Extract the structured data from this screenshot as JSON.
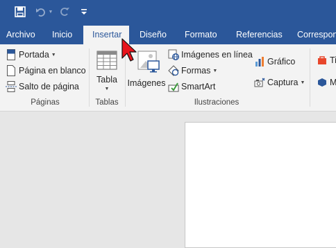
{
  "qat": {
    "save_icon": "save-icon",
    "undo_icon": "undo-icon",
    "redo_icon": "redo-icon",
    "customize_icon": "customize-qat-icon"
  },
  "tabs": [
    "Archivo",
    "Inicio",
    "Insertar",
    "Diseño",
    "Formato",
    "Referencias",
    "Correspon"
  ],
  "active_tab": "Insertar",
  "ribbon": {
    "pages": {
      "items": [
        "Portada",
        "Página en blanco",
        "Salto de página"
      ],
      "label": "Páginas"
    },
    "tables": {
      "button": "Tabla",
      "label": "Tablas"
    },
    "illustrations": {
      "images": "Imágenes",
      "online_images": "Imágenes en línea",
      "shapes": "Formas",
      "smartart": "SmartArt",
      "chart": "Gráfico",
      "screenshot": "Captura",
      "label": "Ilustraciones"
    },
    "partial": [
      "Ti",
      "M"
    ]
  },
  "colors": {
    "brand": "#2b579a",
    "ribbon_bg": "#f3f3f3",
    "doc_bg": "#e6e6e6",
    "cursor": "#e8141c"
  }
}
